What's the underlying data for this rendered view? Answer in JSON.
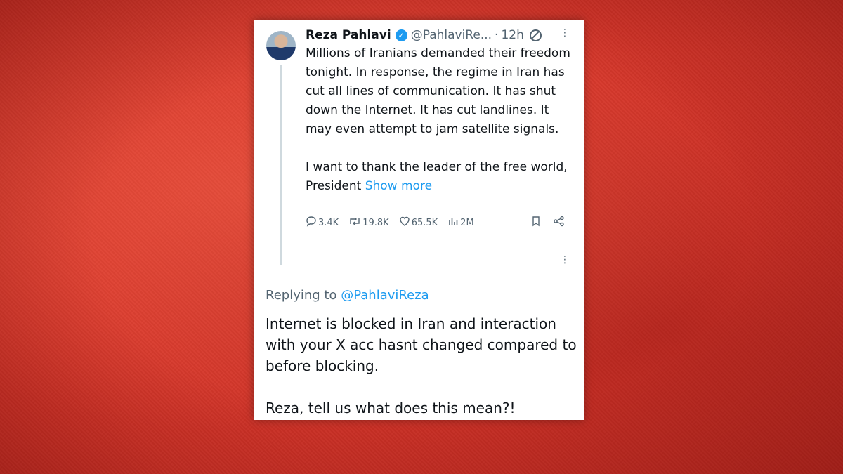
{
  "tweet": {
    "author_name": "Reza Pahlavi",
    "verified_icon": "verified-badge",
    "handle": "@PahlaviRe...",
    "separator": "·",
    "time": "12h",
    "paragraph1": "Millions of Iranians demanded their freedom tonight. In response, the regime in Iran has cut all lines of communication. It has shut down the Internet. It has cut landlines. It may even attempt to jam satellite signals.",
    "paragraph2": "I want to thank the leader of the free world, President",
    "show_more": "Show more",
    "replies": "3.4K",
    "reposts": "19.8K",
    "likes": "65.5K",
    "views": "2M"
  },
  "reply": {
    "replying_to_label": "Replying to",
    "replying_to_handle": "@PahlaviReza",
    "paragraph1": "Internet is blocked in Iran and interaction with your X acc hasnt changed compared to before blocking.",
    "paragraph2": "Reza, tell us what does this mean?!"
  },
  "colors": {
    "background": "#d8362a",
    "link": "#1d9bf0",
    "text": "#0f1419",
    "muted": "#536471"
  }
}
